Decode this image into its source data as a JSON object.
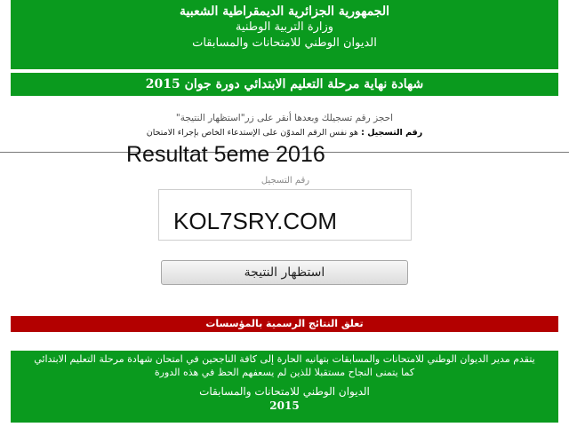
{
  "header": {
    "line1": "الجمهورية الجزائرية الديمقراطية الشعبية",
    "line2": "وزارة التربية الوطنية",
    "line3": "الديوان الوطني للامتحانات والمسابقات"
  },
  "title_bar": "شهادة نهاية مرحلة التعليم الابتدائي دورة جوان 2015",
  "instructions": {
    "line1": "احجز رقم تسجيلك وبعدها أنقر على زر\"استظهار النتيجة\"",
    "line2_label": "رقم التسجيل :",
    "line2_text": "هو نفس الرقم المدوّن على الإستدعاء الخاص بإجراء الامتحان"
  },
  "overlay_text": "Resultat 5eme 2016",
  "form": {
    "field_label": "رقم التسجيل",
    "input_value": "KOL7SRY.COM",
    "submit_label": "استظهار النتيجة"
  },
  "red_bar": "تعلق النتائج الرسمية بالمؤسسات",
  "footer": {
    "line1": "يتقدم مدير الديوان الوطني للامتحانات والمسابقات بتهانيه الحارة إلى كافة الناجحين في امتحان شهادة مرحلة التعليم الابتدائي",
    "line2": "كما يتمنى النجاح مستقبلا للذين لم يسعفهم الحظ في هذه الدورة",
    "line3": "الديوان الوطني للامتحانات والمسابقات",
    "line4": "2015"
  },
  "colors": {
    "green": "#0a9a1e",
    "red": "#b30000"
  }
}
